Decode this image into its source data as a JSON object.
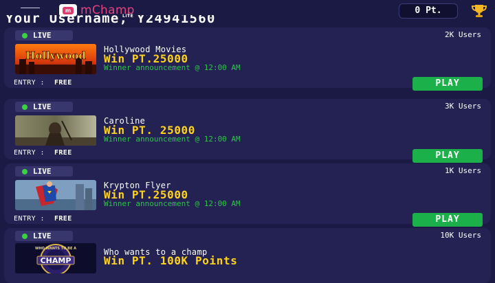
{
  "header": {
    "logo_mark": "m",
    "app_name": "mChamp",
    "app_edition": "LITE",
    "points": "0 Pt.",
    "menu_icon": "hamburger-icon",
    "trophy_icon": "trophy-icon"
  },
  "username_line": "Your Username, Y24941560",
  "games": [
    {
      "status": "LIVE",
      "users": "2K Users",
      "title": "Hollywood Movies",
      "prize": "Win PT.25000",
      "announcement": "Winner announcement @ 12:00 AM",
      "entry_label": "ENTRY :",
      "entry_value": "FREE",
      "action": "PLAY",
      "thumb_text": "Hollywood"
    },
    {
      "status": "LIVE",
      "users": "3K Users",
      "title": "Caroline",
      "prize": "Win PT. 25000",
      "announcement": "Winner announcement @ 12:00 AM",
      "entry_label": "ENTRY :",
      "entry_value": "FREE",
      "action": "PLAY"
    },
    {
      "status": "LIVE",
      "users": "1K Users",
      "title": "Krypton Flyer",
      "prize": "Win PT.25000",
      "announcement": "Winner announcement @ 12:00 AM",
      "entry_label": "ENTRY :",
      "entry_value": "FREE",
      "action": "PLAY"
    },
    {
      "status": "LIVE",
      "users": "10K Users",
      "title": "Who wants to a champ",
      "prize": "Win PT. 100K Points",
      "thumb_text": "CHAMP",
      "thumb_ring_text": "WHO WANTS TO BE A"
    }
  ],
  "colors": {
    "background": "#1b1a45",
    "card": "#232252",
    "prize": "#ffd21f",
    "announcement": "#2fc24d",
    "play_button": "#1cb04a",
    "brand": "#e3437e"
  }
}
